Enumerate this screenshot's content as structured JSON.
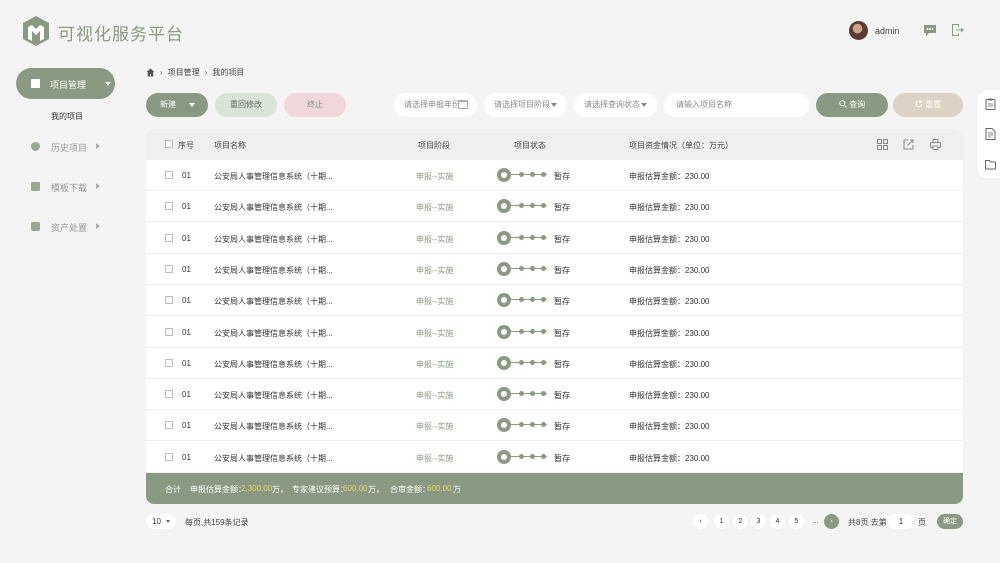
{
  "header": {
    "app_title": "可视化服务平台",
    "username": "admin",
    "icons": [
      "message-icon",
      "logout-icon"
    ]
  },
  "sidebar": {
    "active": {
      "label": "项目管理",
      "icon": "folder-icon"
    },
    "active_sub": "我的项目",
    "items": [
      {
        "label": "历史项目",
        "icon": "clock-icon"
      },
      {
        "label": "模板下载",
        "icon": "download-icon"
      },
      {
        "label": "资产处置",
        "icon": "wallet-icon"
      }
    ]
  },
  "breadcrumb": [
    "项目管理",
    "我的项目"
  ],
  "toolbar": {
    "new_label": "新建",
    "recall_label": "重回修改",
    "stop_label": "终止",
    "year_placeholder": "请选择申报年份",
    "stage_placeholder": "请选择项目阶段",
    "status_placeholder": "请选择查询状态",
    "name_placeholder": "请输入项目名称",
    "search_label": "查询",
    "reset_label": "重置"
  },
  "table": {
    "columns": [
      "序号",
      "项目名称",
      "项目阶段",
      "项目状态",
      "项目资金情况（单位：万元）"
    ],
    "rows": [
      {
        "no": "01",
        "name": "公安局人事管理信息系统（十期...",
        "stage": "申报--实施",
        "status": "暂存",
        "funds": "申报估算金额：230.00"
      },
      {
        "no": "01",
        "name": "公安局人事管理信息系统（十期...",
        "stage": "申报--实施",
        "status": "暂存",
        "funds": "申报估算金额：230.00"
      },
      {
        "no": "01",
        "name": "公安局人事管理信息系统（十期...",
        "stage": "申报--实施",
        "status": "暂存",
        "funds": "申报估算金额：230.00"
      },
      {
        "no": "01",
        "name": "公安局人事管理信息系统（十期...",
        "stage": "申报--实施",
        "status": "暂存",
        "funds": "申报估算金额：230.00"
      },
      {
        "no": "01",
        "name": "公安局人事管理信息系统（十期...",
        "stage": "申报--实施",
        "status": "暂存",
        "funds": "申报估算金额：230.00"
      },
      {
        "no": "01",
        "name": "公安局人事管理信息系统（十期...",
        "stage": "申报--实施",
        "status": "暂存",
        "funds": "申报估算金额：230.00"
      },
      {
        "no": "01",
        "name": "公安局人事管理信息系统（十期...",
        "stage": "申报--实施",
        "status": "暂存",
        "funds": "申报估算金额：230.00"
      },
      {
        "no": "01",
        "name": "公安局人事管理信息系统（十期...",
        "stage": "申报--实施",
        "status": "暂存",
        "funds": "申报估算金额：230.00"
      },
      {
        "no": "01",
        "name": "公安局人事管理信息系统（十期...",
        "stage": "申报--实施",
        "status": "暂存",
        "funds": "申报估算金额：230.00"
      },
      {
        "no": "01",
        "name": "公安局人事管理信息系统（十期...",
        "stage": "申报--实施",
        "status": "暂存",
        "funds": "申报估算金额：230.00"
      }
    ],
    "footer": {
      "total_label": "合计",
      "estimate_label": "申报估算金额：",
      "estimate_value": "2,300.00",
      "estimate_unit": "万，",
      "expert_label": "专家建议预算：",
      "expert_value": "600.00",
      "expert_unit": "万，",
      "audit_label": "合审金额：",
      "audit_value": "600.00",
      "audit_unit": "万"
    }
  },
  "pagination": {
    "page_size": "10",
    "summary": "每页,共159条记录",
    "pages": [
      "1",
      "2",
      "3",
      "4",
      "5"
    ],
    "ellipsis": "...",
    "total_pages": "共8页 去第",
    "goto_value": "1",
    "unit": "页",
    "confirm": "确定"
  },
  "colors": {
    "accent": "#8a9a82",
    "highlight": "#f1d36a",
    "reset": "#ddd3c4",
    "stop": "#f1d7d9"
  }
}
